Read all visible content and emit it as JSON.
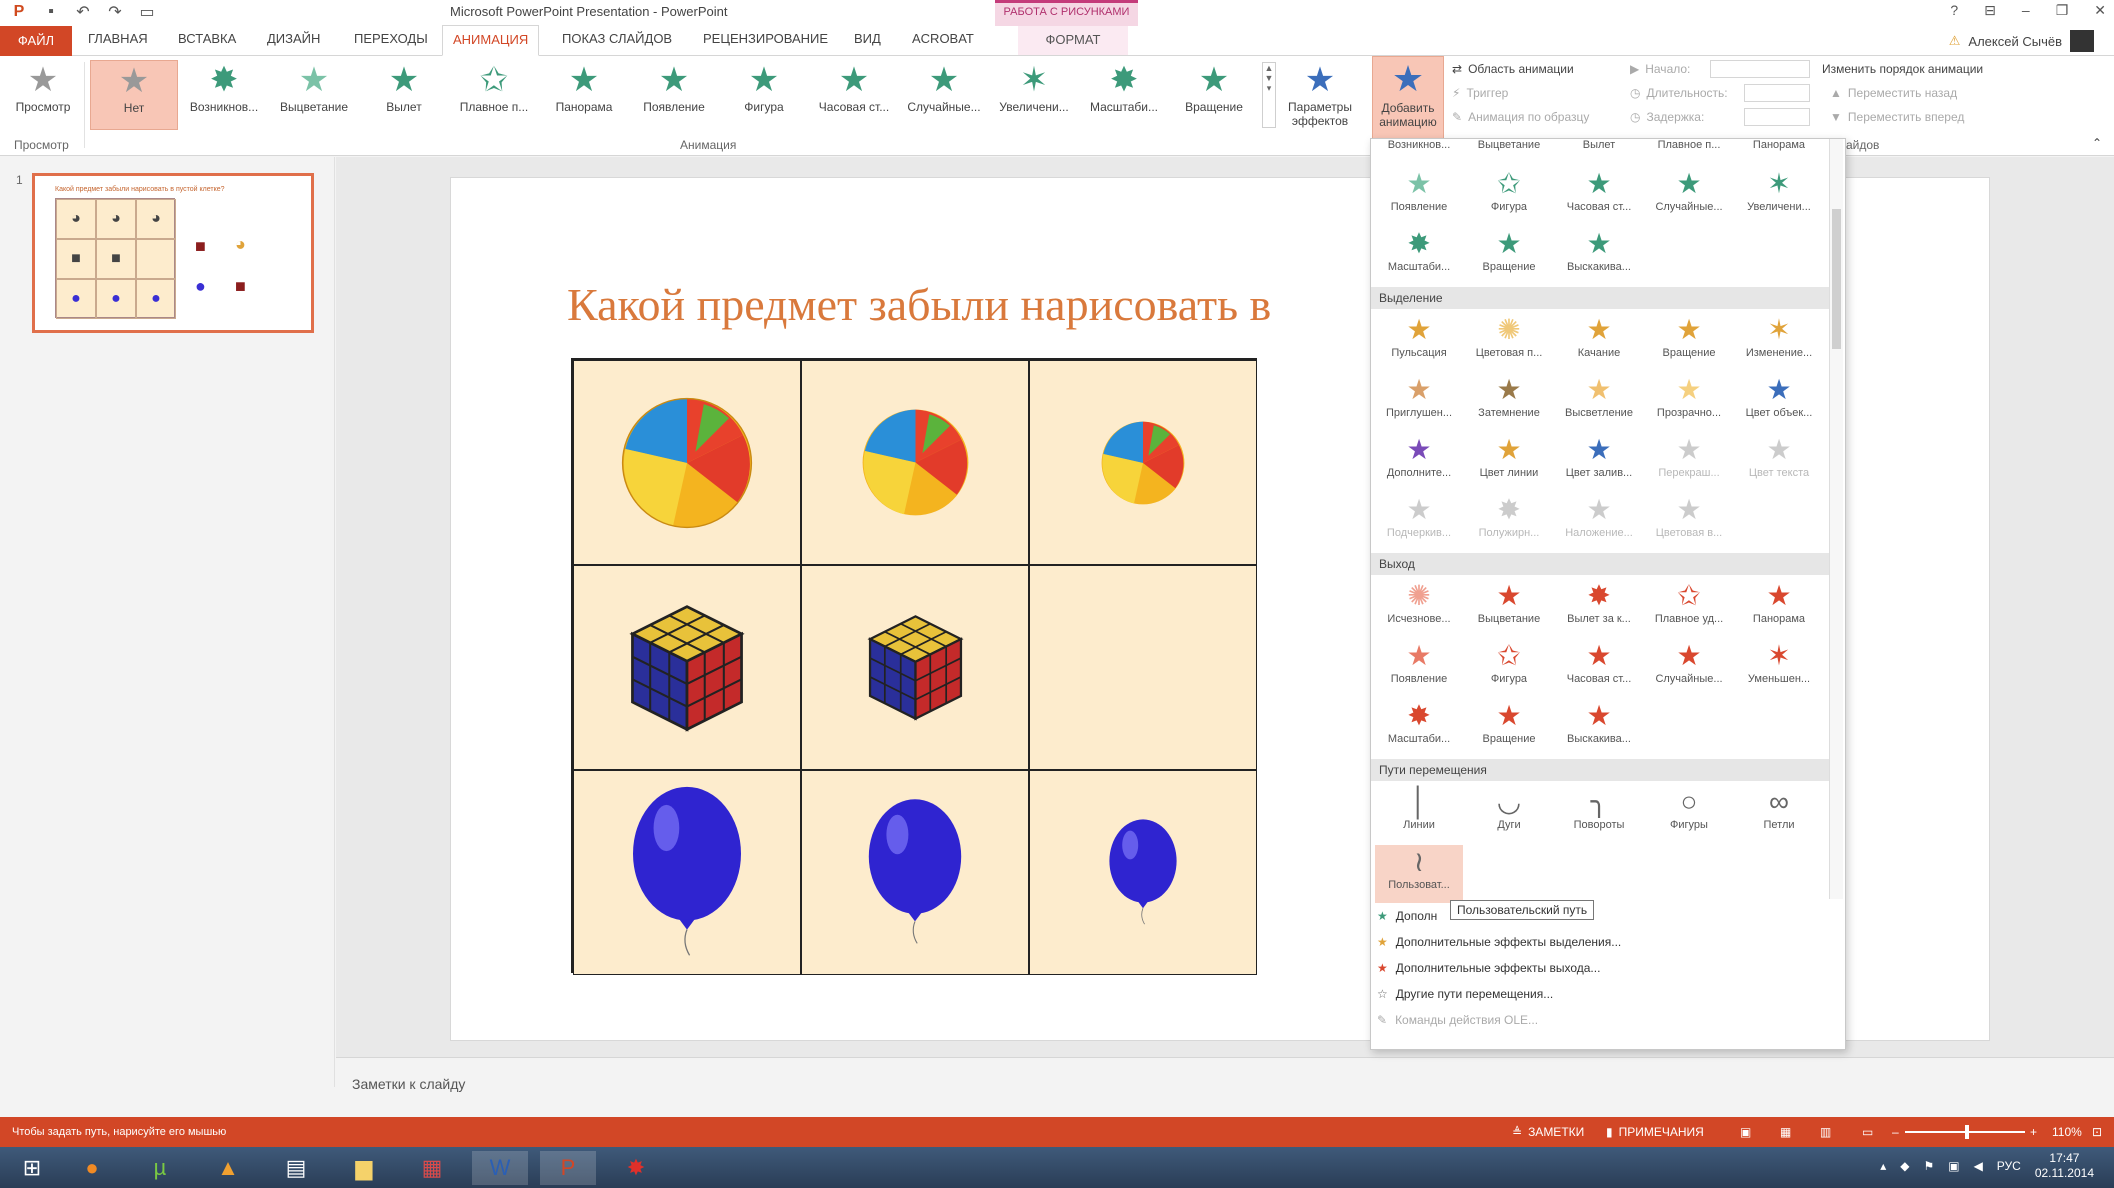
{
  "titlebar": {
    "title": "Microsoft PowerPoint Presentation - PowerPoint",
    "context_group": "РАБОТА С РИСУНКАМИ",
    "controls": [
      "?",
      "⊟",
      "–",
      "❐",
      "✕"
    ]
  },
  "tabs": {
    "file": "ФАЙЛ",
    "items": [
      "ГЛАВНАЯ",
      "ВСТАВКА",
      "ДИЗАЙН",
      "ПЕРЕХОДЫ",
      "АНИМАЦИЯ",
      "ПОКАЗ СЛАЙДОВ",
      "РЕЦЕНЗИРОВАНИЕ",
      "ВИД",
      "ACROBAT"
    ],
    "format": "ФОРМАТ",
    "user": "Алексей Сычёв"
  },
  "ribbon": {
    "preview": "Просмотр",
    "preview_group": "Просмотр",
    "anim_group": "Анимация",
    "gallery": [
      "Нет",
      "Возникнов...",
      "Выцветание",
      "Вылет",
      "Плавное п...",
      "Панорама",
      "Появление",
      "Фигура",
      "Часовая ст...",
      "Случайные...",
      "Увеличени...",
      "Масштаби...",
      "Вращение"
    ],
    "effect_params": "Параметры эффектов",
    "add_animation": "Добавить анимацию",
    "anim_pane": "Область анимации",
    "trigger": "Триггер",
    "anim_painter": "Анимация по образцу",
    "start": "Начало:",
    "duration": "Длительность:",
    "delay": "Задержка:",
    "reorder": "Изменить порядок анимации",
    "move_back": "Переместить назад",
    "move_forward": "Переместить вперед",
    "slides_label": "айдов"
  },
  "slide": {
    "title": "Какой предмет забыли нарисовать в",
    "thumb_title": "Какой предмет забыли нарисовать в пустой клетке?",
    "number": "1"
  },
  "gallery": {
    "entrance_top": [
      "Возникнов...",
      "Выцветание",
      "Вылет",
      "Плавное п...",
      "Панорама"
    ],
    "entrance": [
      "Появление",
      "Фигура",
      "Часовая ст...",
      "Случайные...",
      "Увеличени...",
      "Масштаби...",
      "Вращение",
      "Выскакива..."
    ],
    "emphasis_header": "Выделение",
    "emphasis": [
      "Пульсация",
      "Цветовая п...",
      "Качание",
      "Вращение",
      "Изменение...",
      "Приглушен...",
      "Затемнение",
      "Высветление",
      "Прозрачно...",
      "Цвет объек...",
      "Дополните...",
      "Цвет линии",
      "Цвет залив...",
      "Перекраш...",
      "Цвет текста",
      "Подчеркив...",
      "Полужирн...",
      "Наложение...",
      "Цветовая в..."
    ],
    "exit_header": "Выход",
    "exit": [
      "Исчезнове...",
      "Выцветание",
      "Вылет за к...",
      "Плавное уд...",
      "Панорама",
      "Появление",
      "Фигура",
      "Часовая ст...",
      "Случайные...",
      "Уменьшен...",
      "Масштаби...",
      "Вращение",
      "Выскакива..."
    ],
    "paths_header": "Пути перемещения",
    "paths": [
      "Линии",
      "Дуги",
      "Повороты",
      "Фигуры",
      "Петли",
      "Пользоват..."
    ],
    "more": [
      "Дополнительные эффекты входа...",
      "Дополнительные эффекты выделения...",
      "Дополнительные эффекты выхода...",
      "Другие пути перемещения...",
      "Команды действия OLE..."
    ],
    "more_visible_0": "Дополн",
    "tooltip": "Пользовательский путь"
  },
  "notes": "Заметки к слайду",
  "status": {
    "hint": "Чтобы задать путь, нарисуйте его мышью",
    "notes": "ЗАМЕТКИ",
    "comments": "ПРИМЕЧАНИЯ",
    "zoom": "110%"
  },
  "tray": {
    "lang": "РУС",
    "time": "17:47",
    "date": "02.11.2014"
  },
  "colors": {
    "accent": "#d24726",
    "entrance": "#3d9a7a",
    "emphasis": "#e0a33a",
    "exit": "#d9482f",
    "slide_title": "#d9793c",
    "cell": "#fdeccd"
  }
}
